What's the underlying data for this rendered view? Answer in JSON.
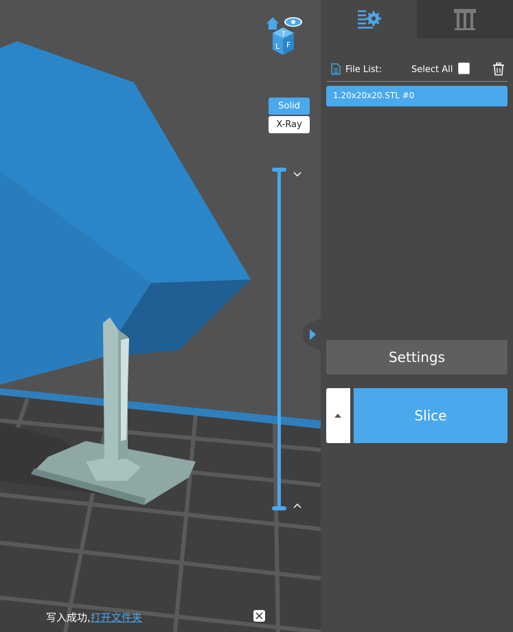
{
  "viewport": {
    "view_modes": {
      "solid_label": "Solid",
      "xray_label": "X-Ray",
      "active": "Solid"
    },
    "view_cube": {
      "faces": [
        "T",
        "L",
        "F"
      ]
    },
    "status": {
      "message": "写入成功,",
      "link": "打开文件夹"
    }
  },
  "panel": {
    "tabs": [
      {
        "icon": "slice-settings-icon",
        "active": true
      },
      {
        "icon": "support-icon",
        "active": false
      }
    ],
    "file_list": {
      "label": "File List:",
      "select_all_label": "Select All",
      "items": [
        {
          "name": "1.20x20x20.STL #0",
          "selected": true
        }
      ]
    },
    "settings_label": "Settings",
    "slice_label": "Slice"
  },
  "colors": {
    "accent": "#4aa8ec",
    "panel_bg": "#474747",
    "viewport_bg": "#525252",
    "model": "#2a86c8"
  }
}
